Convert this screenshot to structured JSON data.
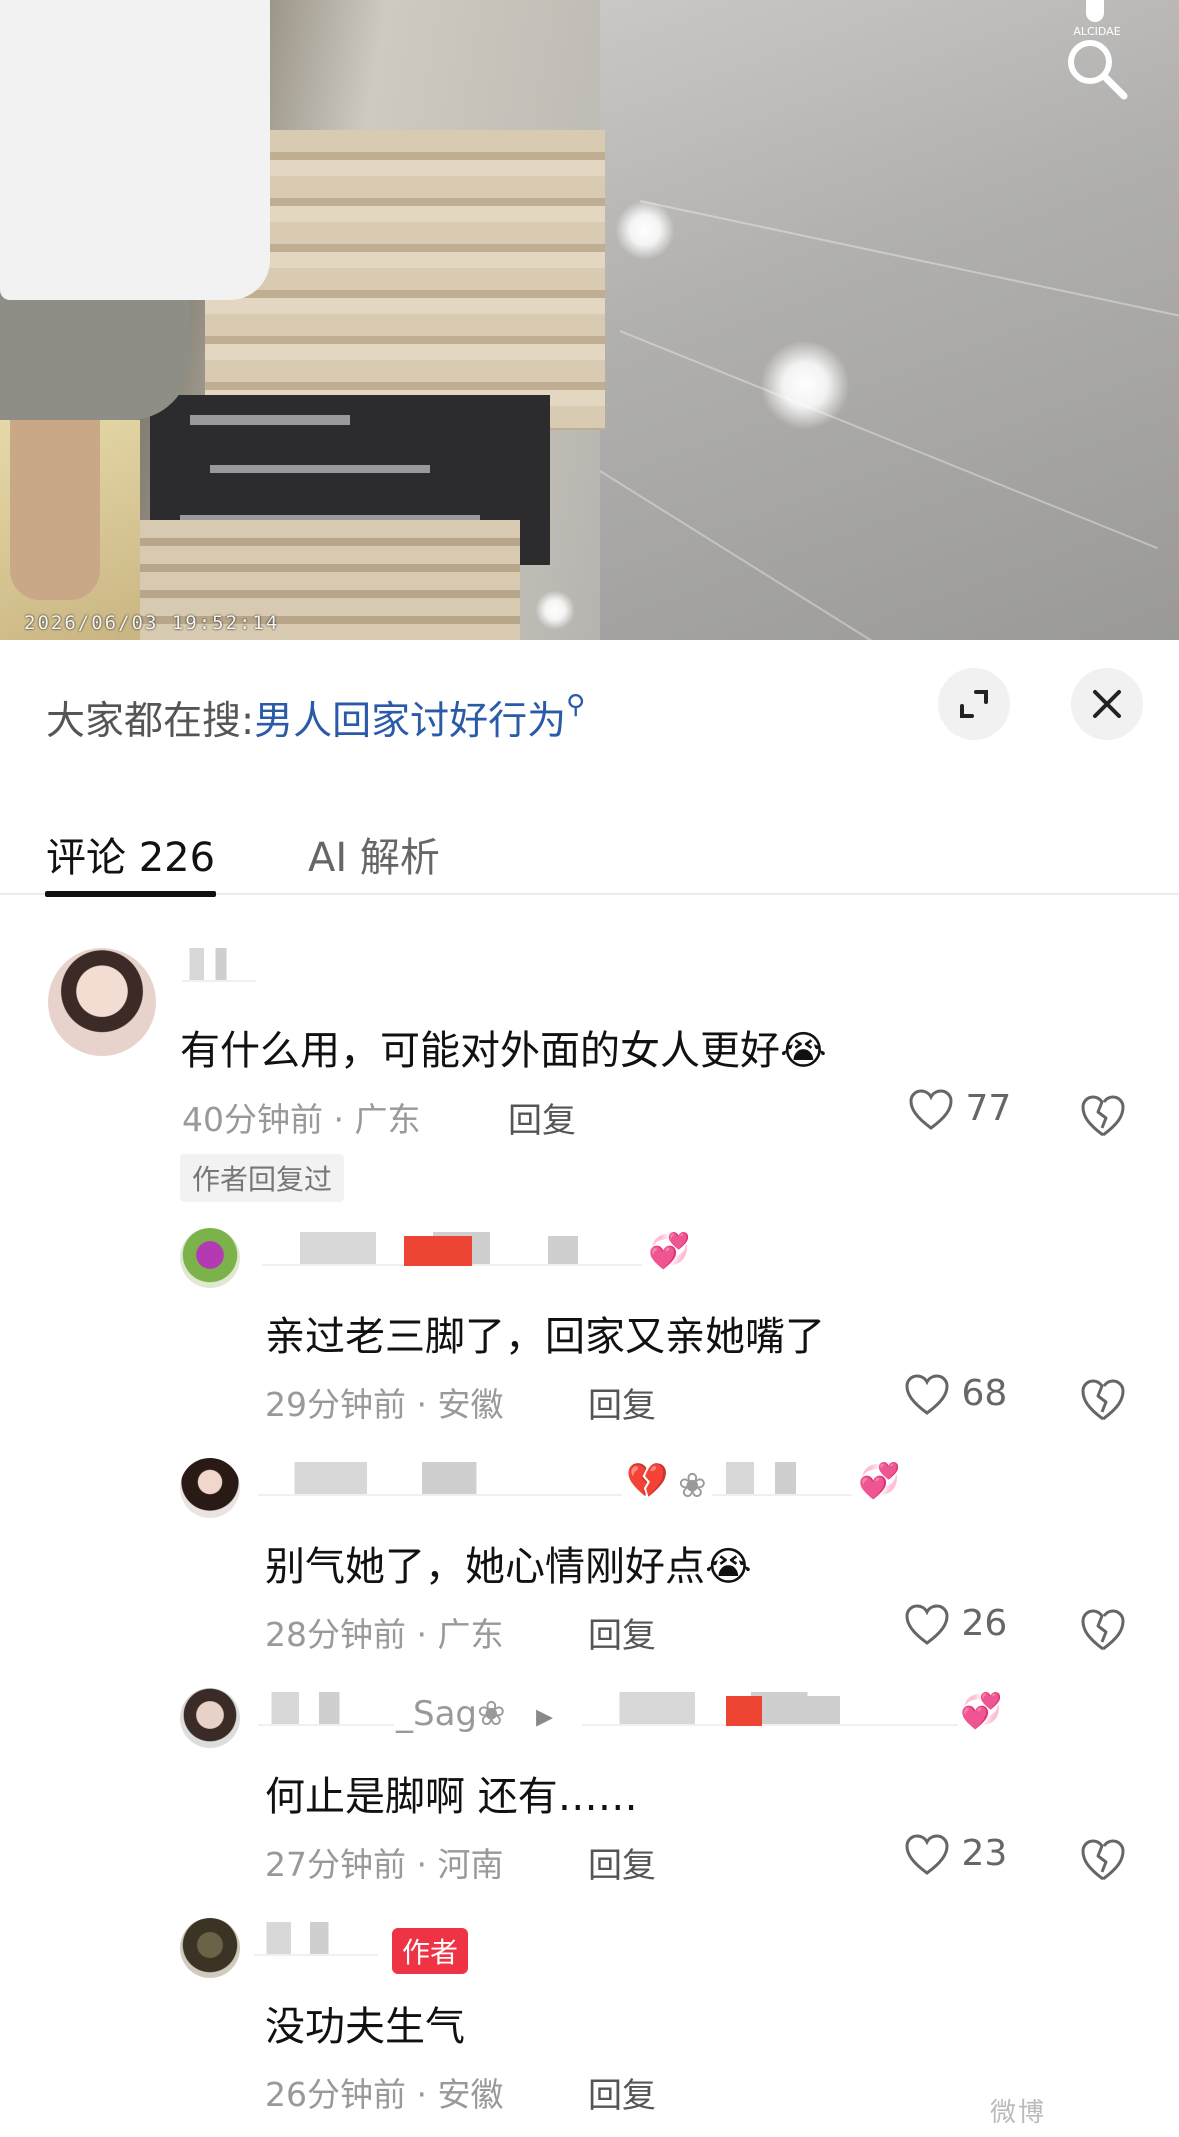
{
  "video": {
    "timestamp": "2026/06/03  19:52:14",
    "logo_text": "ALCIDAE",
    "search_icon": "search-icon"
  },
  "sheet": {
    "hot_search_prefix": "大家都在搜:",
    "hot_search_keyword": "男人回家讨好行为",
    "hot_search_icon": "magnifier-icon",
    "expand_icon": "expand-icon",
    "close_icon": "close-icon"
  },
  "tabs": {
    "comments": "评论 226",
    "ai": "AI 解析"
  },
  "comments": [
    {
      "text": "有什么用，可能对外面的女人更好",
      "emoji": "😭",
      "time": "40分钟前 · 广东",
      "reply": "回复",
      "likes": "77",
      "author_replied": "作者回复过"
    },
    {
      "text": "亲过老三脚了，回家又亲她嘴了",
      "time": "29分钟前 · 安徽",
      "reply": "回复",
      "likes": "68",
      "name_emoji": "💞"
    },
    {
      "text": "别气她了，她心情刚好点",
      "emoji": "😭",
      "time": "28分钟前 · 广东",
      "reply": "回复",
      "likes": "26",
      "name_emoji_1": "💔",
      "name_flower": "❀",
      "name_emoji_2": "💞"
    },
    {
      "text": "何止是脚啊 还有……",
      "time": "27分钟前 · 河南",
      "reply": "回复",
      "likes": "23",
      "name_fragment": "_Sag❀",
      "name_arrow": "▸",
      "name_emoji": "💞"
    },
    {
      "text": "没功夫生气",
      "time": "26分钟前 · 安徽",
      "reply": "回复",
      "author_badge": "作者"
    }
  ],
  "watermark": "微博"
}
